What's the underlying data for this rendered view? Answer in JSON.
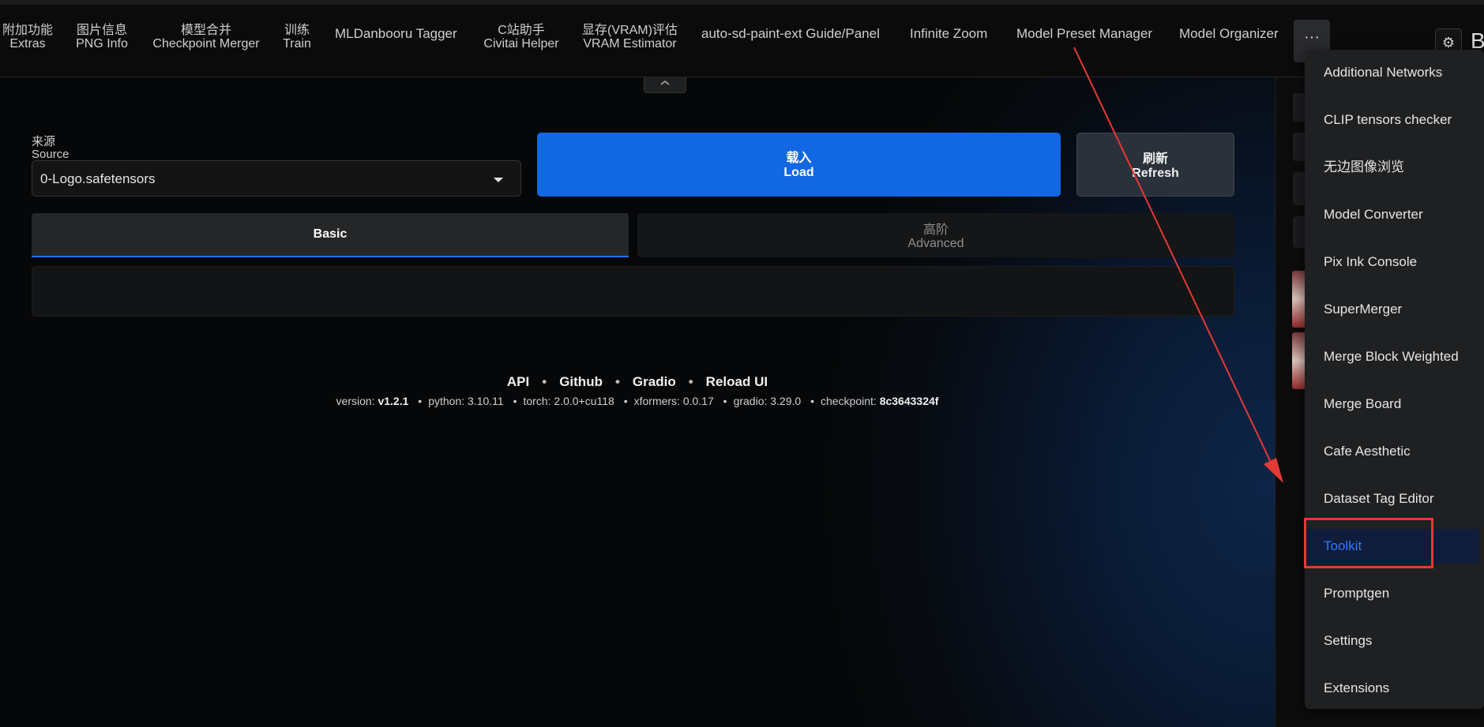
{
  "nav": {
    "tabs": [
      {
        "line1": "附加功能",
        "line2": "Extras"
      },
      {
        "line1": "图片信息",
        "line2": "PNG Info"
      },
      {
        "line1": "模型合并",
        "line2": "Checkpoint Merger"
      },
      {
        "line1": "训练",
        "line2": "Train"
      },
      {
        "line1": "MLDanbooru Tagger"
      },
      {
        "line1": "C站助手",
        "line2": "Civitai Helper"
      },
      {
        "line1": "显存(VRAM)评估",
        "line2": "VRAM Estimator"
      },
      {
        "line1": "auto-sd-paint-ext Guide/Panel"
      },
      {
        "line1": "Infinite Zoom"
      },
      {
        "line1": "Model Preset Manager"
      },
      {
        "line1": "Model Organizer"
      }
    ],
    "more_label": "···",
    "top_right_icon": "⚙",
    "top_right_letter": "B"
  },
  "source": {
    "label_cn": "来源",
    "label_en": "Source",
    "selected": "0-Logo.safetensors"
  },
  "buttons": {
    "load_cn": "载入",
    "load_en": "Load",
    "refresh_cn": "刷新",
    "refresh_en": "Refresh"
  },
  "tabs": {
    "basic": "Basic",
    "advanced_cn": "高阶",
    "advanced_en": "Advanced"
  },
  "footer": {
    "links": [
      "API",
      "Github",
      "Gradio",
      "Reload UI"
    ],
    "version_label": "version:",
    "version": "v1.2.1",
    "python": "python: 3.10.11",
    "torch": "torch: 2.0.0+cu118",
    "xformers": "xformers: 0.0.17",
    "gradio": "gradio: 3.29.0",
    "checkpoint_label": "checkpoint:",
    "checkpoint": "8c3643324f"
  },
  "dropdown": {
    "items": [
      "Additional Networks",
      "CLIP tensors checker",
      "无边图像浏览",
      "Model Converter",
      "Pix Ink Console",
      "SuperMerger",
      "Merge Block Weighted",
      "Merge Board",
      "Cafe Aesthetic",
      "Dataset Tag Editor",
      "Toolkit",
      "Promptgen",
      "Settings",
      "Extensions"
    ],
    "active_index": 10
  },
  "colors": {
    "accent": "#1268e2",
    "active_item_text": "#2d79ff",
    "annotation": "#e53935"
  }
}
